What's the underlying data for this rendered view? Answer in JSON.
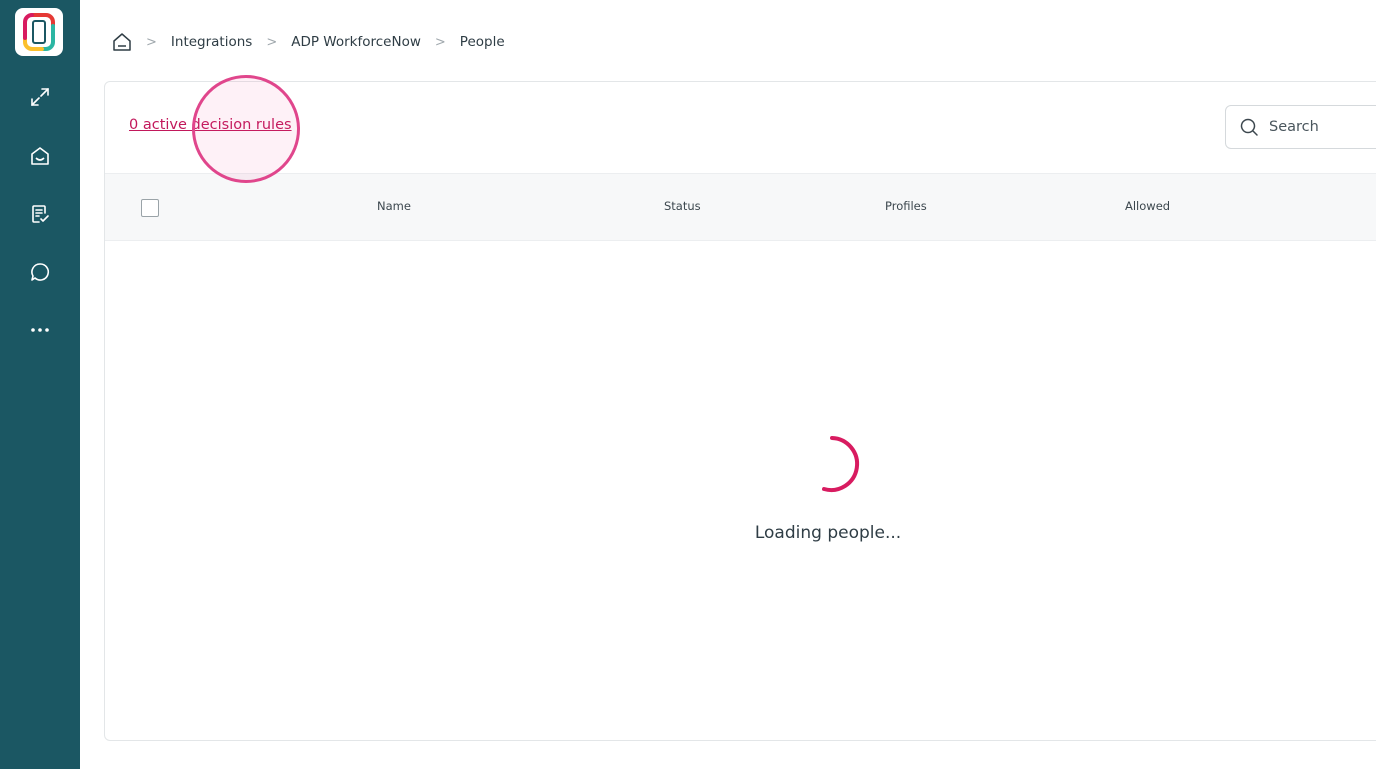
{
  "sidebar": {
    "logo_icon": "app-logo",
    "items": [
      {
        "name": "expand",
        "icon": "expand-icon"
      },
      {
        "name": "inbox",
        "icon": "inbox-icon"
      },
      {
        "name": "tasks",
        "icon": "checklist-icon"
      },
      {
        "name": "chat",
        "icon": "chat-bubble-icon"
      },
      {
        "name": "more",
        "icon": "more-dots-icon"
      }
    ],
    "bg_color": "#1b5763"
  },
  "breadcrumb": {
    "home_icon": "home-icon",
    "items": [
      "Integrations",
      "ADP WorkforceNow",
      "People"
    ],
    "separator": ">"
  },
  "card": {
    "rules_link": "0 active decision rules",
    "search": {
      "placeholder": "Search",
      "value": ""
    },
    "columns": [
      "Name",
      "Status",
      "Profiles",
      "Allowed"
    ],
    "loading_text": "Loading people..."
  },
  "colors": {
    "accent": "#c2185b",
    "spinner": "#d81b60"
  }
}
